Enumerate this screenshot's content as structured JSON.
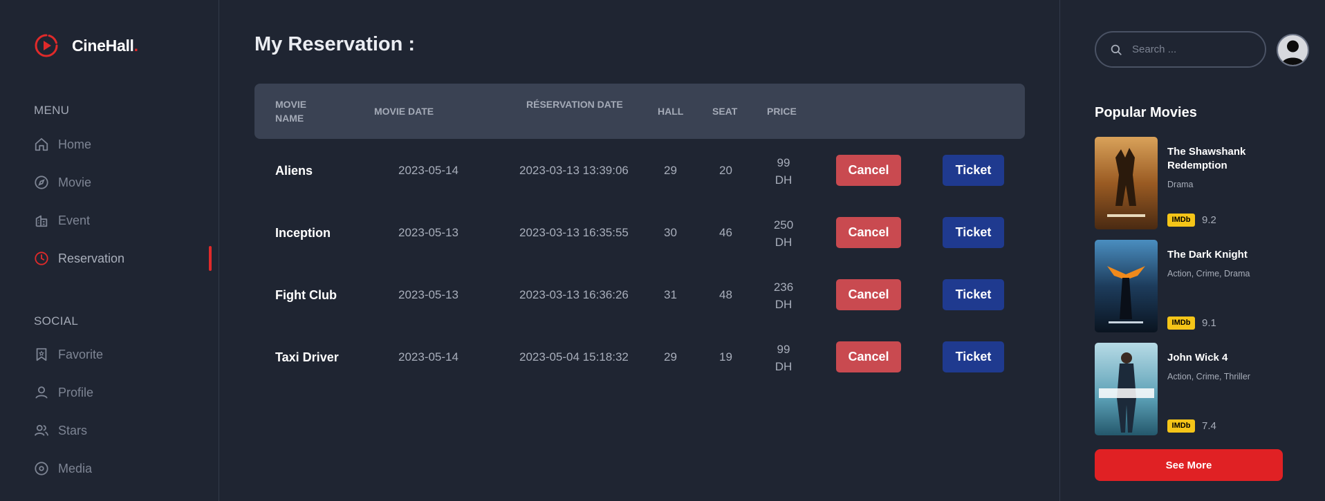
{
  "brand": {
    "name": "CineHall",
    "dot": "."
  },
  "sidebar": {
    "menu_title": "MENU",
    "menu_items": [
      {
        "label": "Home",
        "icon": "home-icon"
      },
      {
        "label": "Movie",
        "icon": "compass-icon"
      },
      {
        "label": "Event",
        "icon": "building-icon"
      },
      {
        "label": "Reservation",
        "icon": "clock-icon",
        "active": true
      }
    ],
    "social_title": "SOCIAL",
    "social_items": [
      {
        "label": "Favorite",
        "icon": "bookmark-icon"
      },
      {
        "label": "Profile",
        "icon": "user-icon"
      },
      {
        "label": "Stars",
        "icon": "users-icon"
      },
      {
        "label": "Media",
        "icon": "disc-icon"
      }
    ]
  },
  "main": {
    "title": "My Reservation :",
    "columns": {
      "movie_name": "MOVIE NAME",
      "movie_date": "MOVIE DATE",
      "reservation_date": "RÉSERVATION DATE",
      "hall": "HALL",
      "seat": "SEAT",
      "price": "PRICE"
    },
    "rows": [
      {
        "name": "Aliens",
        "movie_date": "2023-05-14",
        "reservation_date": "2023-03-13 13:39:06",
        "hall": "29",
        "seat": "20",
        "price": "99",
        "currency": "DH",
        "cancel": "Cancel",
        "ticket": "Ticket"
      },
      {
        "name": "Inception",
        "movie_date": "2023-05-13",
        "reservation_date": "2023-03-13 16:35:55",
        "hall": "30",
        "seat": "46",
        "price": "250",
        "currency": "DH",
        "cancel": "Cancel",
        "ticket": "Ticket"
      },
      {
        "name": "Fight Club",
        "movie_date": "2023-05-13",
        "reservation_date": "2023-03-13 16:36:26",
        "hall": "31",
        "seat": "48",
        "price": "236",
        "currency": "DH",
        "cancel": "Cancel",
        "ticket": "Ticket"
      },
      {
        "name": "Taxi Driver",
        "movie_date": "2023-05-14",
        "reservation_date": "2023-05-04 15:18:32",
        "hall": "29",
        "seat": "19",
        "price": "99",
        "currency": "DH",
        "cancel": "Cancel",
        "ticket": "Ticket"
      }
    ]
  },
  "right": {
    "search_placeholder": "Search ...",
    "popular_title": "Popular Movies",
    "movies": [
      {
        "title": "The Shawshank Redemption",
        "genre": "Drama",
        "imdb": "IMDb",
        "rating": "9.2"
      },
      {
        "title": "The Dark Knight",
        "genre": "Action, Crime, Drama",
        "imdb": "IMDb",
        "rating": "9.1"
      },
      {
        "title": "John Wick 4",
        "genre": "Action, Crime, Thriller",
        "imdb": "IMDb",
        "rating": "7.4"
      }
    ],
    "see_more": "See More"
  },
  "colors": {
    "background": "#1f2532",
    "accent_red": "#e02a2a",
    "cancel": "#c94a50",
    "ticket": "#1f3a8f",
    "table_header": "#3a4253",
    "imdb_yellow": "#f5c518"
  }
}
